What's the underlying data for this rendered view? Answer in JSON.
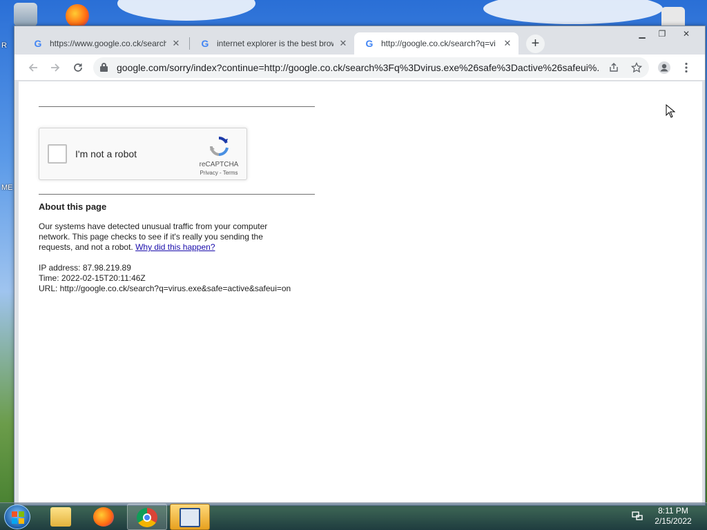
{
  "desktop": {
    "sky_color": "#2a6fd6",
    "grass_color": "#3f7a2a",
    "left_edge_labels": [
      "R",
      "ME"
    ]
  },
  "browser": {
    "tabs": [
      {
        "title": "https://www.google.co.ck/search",
        "icon": "google-g-icon",
        "active": false
      },
      {
        "title": "internet explorer is the best brow",
        "icon": "google-g-icon",
        "active": false
      },
      {
        "title": "http://google.co.ck/search?q=vi",
        "icon": "google-g-icon",
        "active": true
      }
    ],
    "new_tab_glyph": "+",
    "close_glyph": "✕",
    "window_controls": {
      "minimize": "▁",
      "restore": "❐",
      "close": "✕"
    },
    "address_bar": {
      "url": "google.com/sorry/index?continue=http://google.co.ck/search%3Fq%3Dvirus.exe%26safe%3Dactive%26safeui%..."
    }
  },
  "page": {
    "recaptcha": {
      "label": "I'm not a robot",
      "brand": "reCAPTCHA",
      "links": "Privacy - Terms"
    },
    "about_title": "About this page",
    "message_line1": "Our systems have detected unusual traffic from your computer",
    "message_line2": "network. This page checks to see if it's really you sending the",
    "message_line3": "requests, and not a robot. ",
    "why_link": "Why did this happen?",
    "ip_line": "IP address: 87.98.219.89",
    "time_line": "Time: 2022-02-15T20:11:46Z",
    "url_line": "URL: http://google.co.ck/search?q=virus.exe&safe=active&safeui=on"
  },
  "taskbar": {
    "clock_time": "8:11 PM",
    "clock_date": "2/15/2022",
    "apps": [
      "windows-explorer-icon",
      "firefox-icon",
      "chrome-icon",
      "task-app-icon"
    ]
  }
}
